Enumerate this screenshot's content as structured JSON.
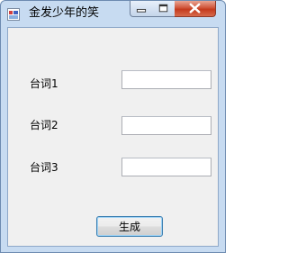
{
  "window": {
    "title": "金发少年的笑"
  },
  "form": {
    "fields": [
      {
        "label": "台词1",
        "value": ""
      },
      {
        "label": "台词2",
        "value": ""
      },
      {
        "label": "台词3",
        "value": ""
      }
    ],
    "generate_label": "生成"
  },
  "colors": {
    "titlebar": "#c7dbf1",
    "client_bg": "#f0f0f0",
    "close_button": "#c43a1d",
    "button_border": "#3c7fb1"
  },
  "icons": [
    "app-icon",
    "minimize-icon",
    "maximize-icon",
    "close-icon"
  ]
}
